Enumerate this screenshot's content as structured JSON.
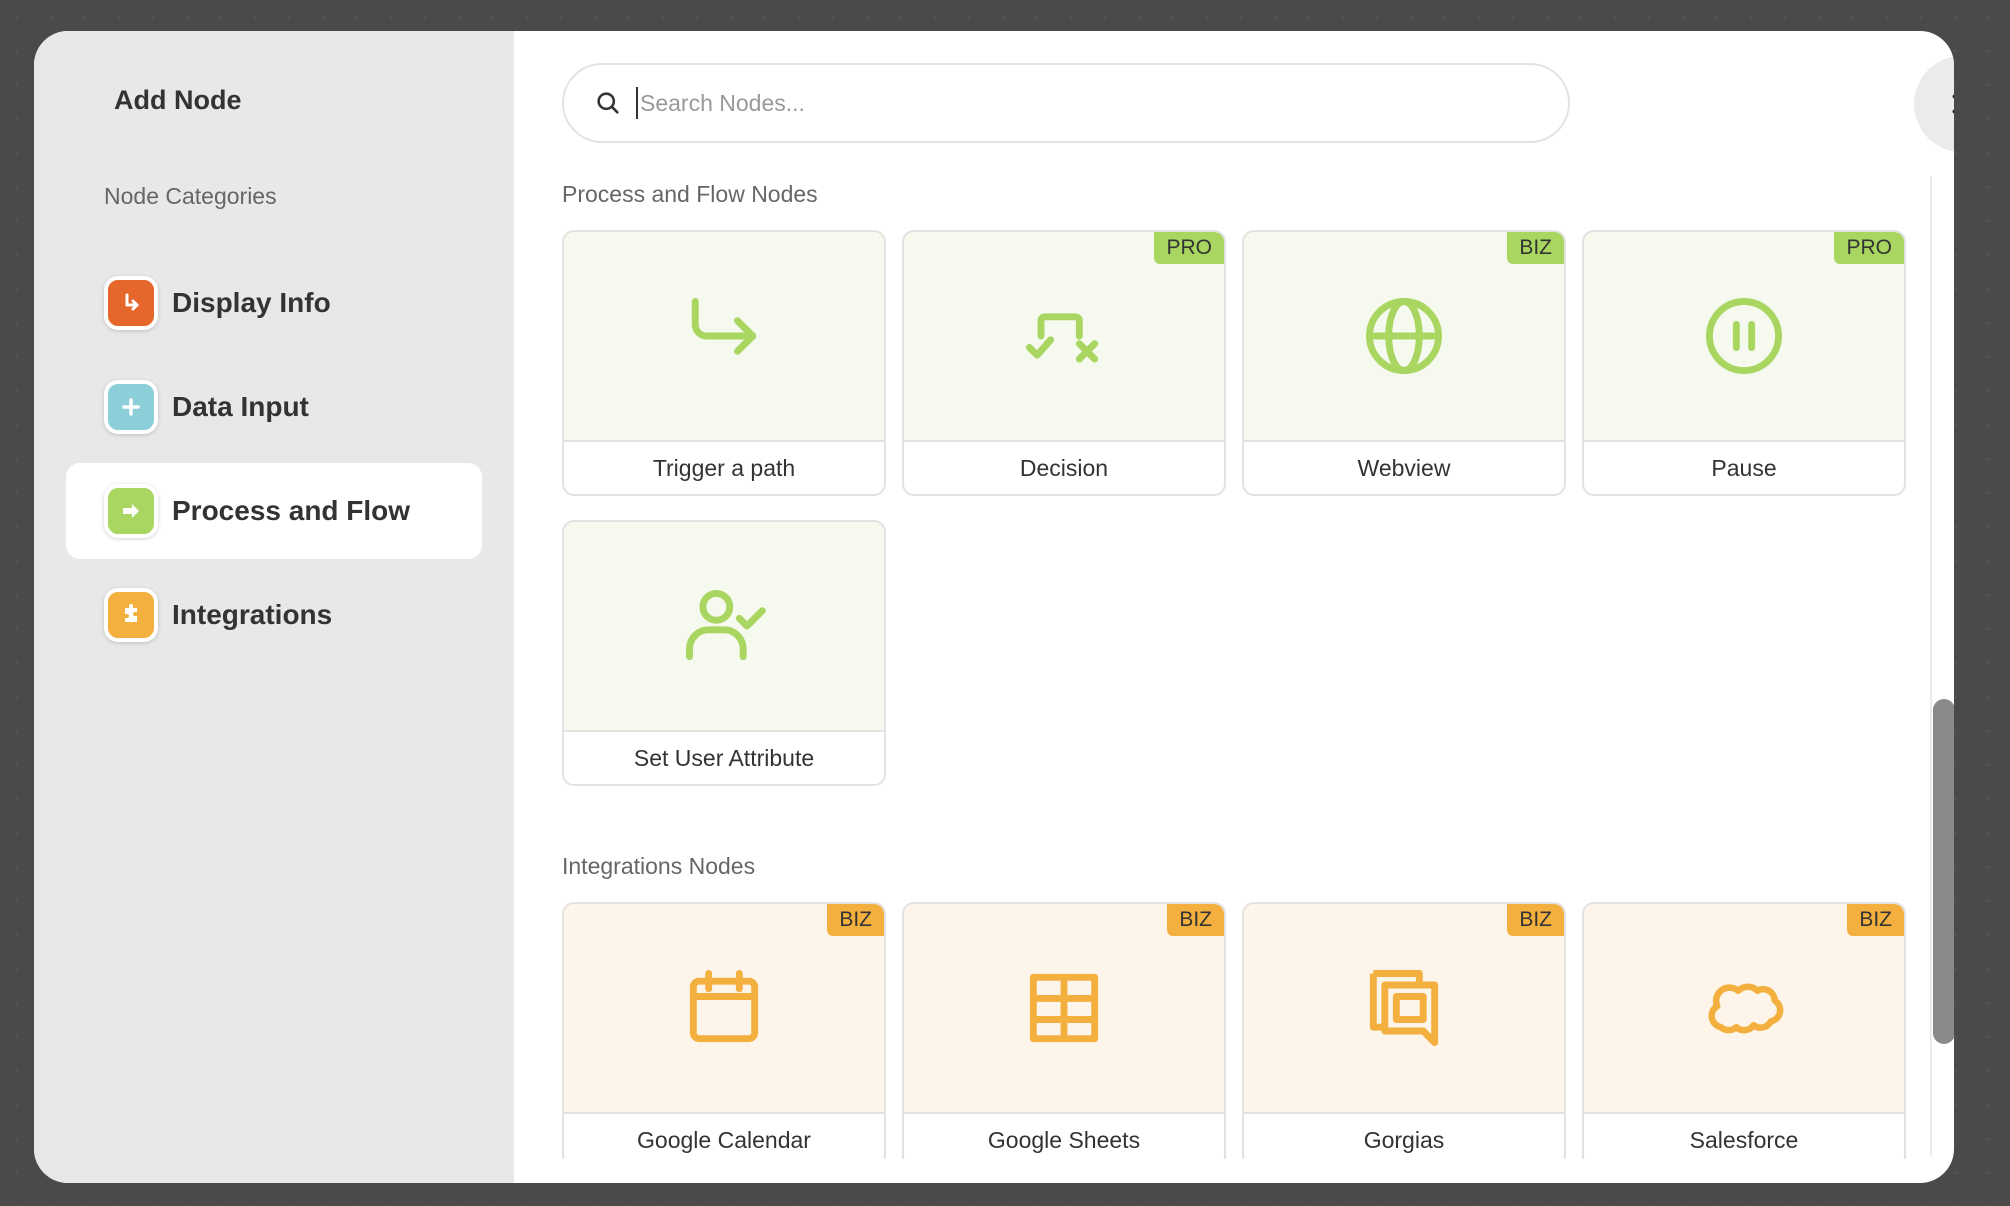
{
  "sidebar": {
    "title": "Add Node",
    "subtitle": "Node Categories",
    "items": [
      {
        "label": "Display Info",
        "icon": "return-arrow-icon",
        "color": "#e5672b",
        "active": false
      },
      {
        "label": "Data Input",
        "icon": "plus-icon",
        "color": "#8ccfd8",
        "active": false
      },
      {
        "label": "Process and Flow",
        "icon": "arrow-right-icon",
        "color": "#a8d661",
        "active": true
      },
      {
        "label": "Integrations",
        "icon": "puzzle-icon",
        "color": "#f4b03f",
        "active": false
      }
    ]
  },
  "search": {
    "placeholder": "Search Nodes...",
    "value": ""
  },
  "sections": [
    {
      "title": "Process and Flow Nodes",
      "color": "#a8d661",
      "nodes": [
        {
          "label": "Trigger a path",
          "icon": "trigger-path-icon",
          "badge": ""
        },
        {
          "label": "Decision",
          "icon": "decision-icon",
          "badge": "PRO"
        },
        {
          "label": "Webview",
          "icon": "globe-icon",
          "badge": "BIZ"
        },
        {
          "label": "Pause",
          "icon": "pause-icon",
          "badge": "PRO"
        },
        {
          "label": "Set User Attribute",
          "icon": "user-check-icon",
          "badge": ""
        }
      ]
    },
    {
      "title": "Integrations Nodes",
      "color": "#f4b03f",
      "nodes": [
        {
          "label": "Google Calendar",
          "icon": "calendar-icon",
          "badge": "BIZ"
        },
        {
          "label": "Google Sheets",
          "icon": "table-icon",
          "badge": "BIZ"
        },
        {
          "label": "Gorgias",
          "icon": "gorgias-icon",
          "badge": "BIZ"
        },
        {
          "label": "Salesforce",
          "icon": "cloud-icon",
          "badge": "BIZ"
        }
      ]
    }
  ]
}
